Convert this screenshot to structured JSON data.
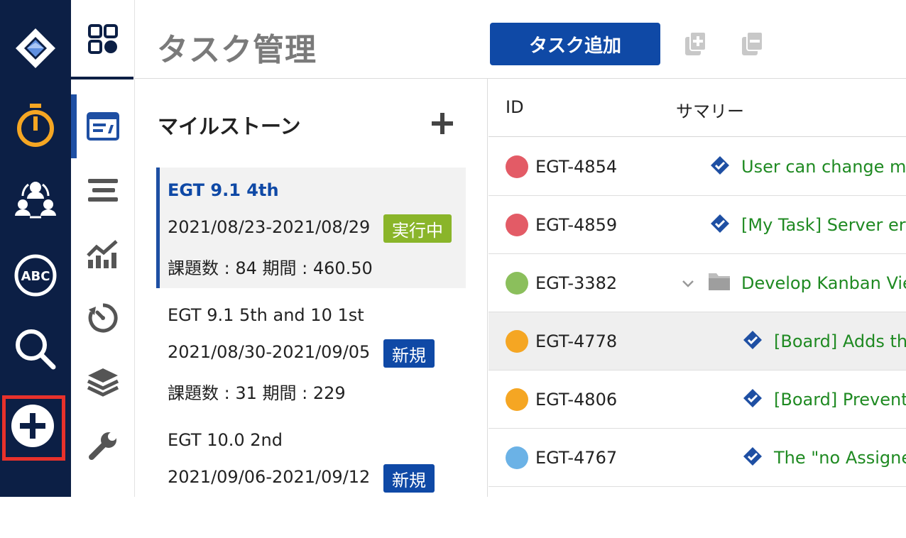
{
  "header": {
    "title": "タスク管理",
    "add_task_label": "タスク追加"
  },
  "nav_icons": [
    "app-logo-icon",
    "stopwatch-icon",
    "team-icon",
    "abc-icon",
    "search-icon",
    "add-circle-icon"
  ],
  "subnav_icons": [
    "apps-grid-icon",
    "board-icon",
    "list-icon",
    "chart-icon",
    "timer-icon",
    "layers-icon",
    "wrench-icon"
  ],
  "milestones": {
    "title": "マイルストーン",
    "items": [
      {
        "name": "EGT 9.1 4th",
        "dates": "2021/08/23-2021/08/29",
        "stats": "課題数 : 84 期間 : 460.50",
        "status": "実行中",
        "status_color": "#8ab52a"
      },
      {
        "name": "EGT 9.1 5th and 10 1st",
        "dates": "2021/08/30-2021/09/05",
        "stats": "課題数 : 31 期間 : 229",
        "status": "新規",
        "status_color": "#0f49a6"
      },
      {
        "name": "EGT 10.0 2nd",
        "dates": "2021/09/06-2021/09/12",
        "stats": "",
        "status": "新規",
        "status_color": "#0f49a6"
      }
    ]
  },
  "table": {
    "headers": {
      "id": "ID",
      "summary": "サマリー"
    },
    "rows": [
      {
        "key": "EGT-4854",
        "summary": "User can change mil",
        "priority_color": "#e35b66",
        "icon": "task-icon"
      },
      {
        "key": "EGT-4859",
        "summary": "[My Task] Server erro",
        "priority_color": "#e35b66",
        "icon": "task-icon"
      },
      {
        "key": "EGT-3382",
        "summary": "Develop Kanban View",
        "priority_color": "#8bbf5c",
        "icon": "folder-icon"
      },
      {
        "key": "EGT-4778",
        "summary": "[Board] Adds the",
        "priority_color": "#f5a623",
        "icon": "task-icon"
      },
      {
        "key": "EGT-4806",
        "summary": "[Board] Prevents",
        "priority_color": "#f5a623",
        "icon": "task-icon"
      },
      {
        "key": "EGT-4767",
        "summary": "The \"no Assigne",
        "priority_color": "#6bb2e6",
        "icon": "task-icon"
      }
    ]
  }
}
